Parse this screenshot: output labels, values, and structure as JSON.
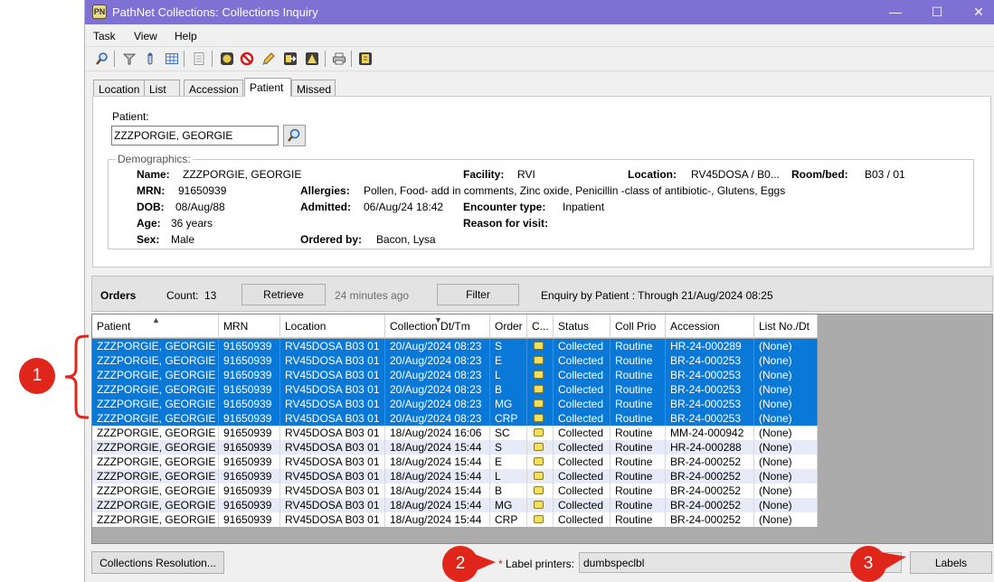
{
  "window": {
    "title": "PathNet Collections: Collections Inquiry",
    "app_icon_text": "PN",
    "minimize": "—",
    "maximize": "☐",
    "close": "✕"
  },
  "menu": [
    "Task",
    "View",
    "Help"
  ],
  "tabs": [
    "Location",
    "List",
    "Accession",
    "Patient",
    "Missed"
  ],
  "active_tab": "Patient",
  "patient_panel": {
    "patient_label": "Patient:",
    "patient_value": "ZZZPORGIE, GEORGIE",
    "demographics_legend": "Demographics:",
    "name_label": "Name:",
    "name": "ZZZPORGIE, GEORGIE",
    "mrn_label": "MRN:",
    "mrn": "91650939",
    "dob_label": "DOB:",
    "dob": "08/Aug/88",
    "age_label": "Age:",
    "age": "36 years",
    "sex_label": "Sex:",
    "sex": "Male",
    "allergies_label": "Allergies:",
    "allergies": "Pollen, Food- add in comments, Zinc oxide, Penicillin -class of antibiotic-, Glutens, Eggs",
    "admitted_label": "Admitted:",
    "admitted": "06/Aug/24 18:42",
    "ordered_by_label": "Ordered by:",
    "ordered_by": "Bacon, Lysa",
    "facility_label": "Facility:",
    "facility": "RVI",
    "encounter_label": "Encounter type:",
    "encounter": "Inpatient",
    "reason_label": "Reason for visit:",
    "reason": "",
    "location_label": "Location:",
    "location": "RV45DOSA / B0...",
    "roombed_label": "Room/bed:",
    "roombed": "B03 / 01"
  },
  "orders_bar": {
    "title": "Orders",
    "count_label": "Count:",
    "count": "13",
    "retrieve": "Retrieve",
    "elapsed": "24 minutes ago",
    "filter": "Filter",
    "enquiry": "Enquiry by Patient : Through 21/Aug/2024 08:25"
  },
  "grid": {
    "columns": [
      "Patient",
      "MRN",
      "Location",
      "Collection Dt/Tm",
      "Order",
      "C...",
      "Status",
      "Coll Prio",
      "Accession",
      "List No./Dt"
    ],
    "rows": [
      {
        "patient": "ZZZPORGIE, GEORGIE",
        "mrn": "91650939",
        "location": "RV45DOSA B03 01",
        "dt": "20/Aug/2024 08:23",
        "order": "S",
        "status": "Collected",
        "prio": "Routine",
        "accession": "HR-24-000289",
        "list": "(None)",
        "selected": true
      },
      {
        "patient": "ZZZPORGIE, GEORGIE",
        "mrn": "91650939",
        "location": "RV45DOSA B03 01",
        "dt": "20/Aug/2024 08:23",
        "order": "E",
        "status": "Collected",
        "prio": "Routine",
        "accession": "BR-24-000253",
        "list": "(None)",
        "selected": true
      },
      {
        "patient": "ZZZPORGIE, GEORGIE",
        "mrn": "91650939",
        "location": "RV45DOSA B03 01",
        "dt": "20/Aug/2024 08:23",
        "order": "L",
        "status": "Collected",
        "prio": "Routine",
        "accession": "BR-24-000253",
        "list": "(None)",
        "selected": true
      },
      {
        "patient": "ZZZPORGIE, GEORGIE",
        "mrn": "91650939",
        "location": "RV45DOSA B03 01",
        "dt": "20/Aug/2024 08:23",
        "order": "B",
        "status": "Collected",
        "prio": "Routine",
        "accession": "BR-24-000253",
        "list": "(None)",
        "selected": true
      },
      {
        "patient": "ZZZPORGIE, GEORGIE",
        "mrn": "91650939",
        "location": "RV45DOSA B03 01",
        "dt": "20/Aug/2024 08:23",
        "order": "MG",
        "status": "Collected",
        "prio": "Routine",
        "accession": "BR-24-000253",
        "list": "(None)",
        "selected": true
      },
      {
        "patient": "ZZZPORGIE, GEORGIE",
        "mrn": "91650939",
        "location": "RV45DOSA B03 01",
        "dt": "20/Aug/2024 08:23",
        "order": "CRP",
        "status": "Collected",
        "prio": "Routine",
        "accession": "BR-24-000253",
        "list": "(None)",
        "selected": true
      },
      {
        "patient": "ZZZPORGIE, GEORGIE",
        "mrn": "91650939",
        "location": "RV45DOSA B03 01",
        "dt": "18/Aug/2024 16:06",
        "order": "SC",
        "status": "Collected",
        "prio": "Routine",
        "accession": "MM-24-000942",
        "list": "(None)",
        "selected": false
      },
      {
        "patient": "ZZZPORGIE, GEORGIE",
        "mrn": "91650939",
        "location": "RV45DOSA B03 01",
        "dt": "18/Aug/2024 15:44",
        "order": "S",
        "status": "Collected",
        "prio": "Routine",
        "accession": "HR-24-000288",
        "list": "(None)",
        "selected": false
      },
      {
        "patient": "ZZZPORGIE, GEORGIE",
        "mrn": "91650939",
        "location": "RV45DOSA B03 01",
        "dt": "18/Aug/2024 15:44",
        "order": "E",
        "status": "Collected",
        "prio": "Routine",
        "accession": "BR-24-000252",
        "list": "(None)",
        "selected": false
      },
      {
        "patient": "ZZZPORGIE, GEORGIE",
        "mrn": "91650939",
        "location": "RV45DOSA B03 01",
        "dt": "18/Aug/2024 15:44",
        "order": "L",
        "status": "Collected",
        "prio": "Routine",
        "accession": "BR-24-000252",
        "list": "(None)",
        "selected": false
      },
      {
        "patient": "ZZZPORGIE, GEORGIE",
        "mrn": "91650939",
        "location": "RV45DOSA B03 01",
        "dt": "18/Aug/2024 15:44",
        "order": "B",
        "status": "Collected",
        "prio": "Routine",
        "accession": "BR-24-000252",
        "list": "(None)",
        "selected": false
      },
      {
        "patient": "ZZZPORGIE, GEORGIE",
        "mrn": "91650939",
        "location": "RV45DOSA B03 01",
        "dt": "18/Aug/2024 15:44",
        "order": "MG",
        "status": "Collected",
        "prio": "Routine",
        "accession": "BR-24-000252",
        "list": "(None)",
        "selected": false
      },
      {
        "patient": "ZZZPORGIE, GEORGIE",
        "mrn": "91650939",
        "location": "RV45DOSA B03 01",
        "dt": "18/Aug/2024 15:44",
        "order": "CRP",
        "status": "Collected",
        "prio": "Routine",
        "accession": "BR-24-000252",
        "list": "(None)",
        "selected": false
      }
    ]
  },
  "bottom": {
    "collections_resolution": "Collections Resolution...",
    "required_marker": "*",
    "label_printers_label": "Label printers:",
    "label_printers_value": "dumbspeclbl",
    "labels_button": "Labels"
  },
  "callouts": [
    "1",
    "2",
    "3"
  ],
  "colors": {
    "titlebar": "#7f70d4",
    "selection": "#0a78d7",
    "callout": "#e0261a",
    "alt_row": "#e6ebf7"
  },
  "icons": [
    "magnifier-icon",
    "funnel-icon",
    "specimen-tube-icon",
    "grid-icon",
    "document-icon",
    "green-circle-icon",
    "no-entry-icon",
    "pencil-icon",
    "exit-icon",
    "triangle-flask-icon",
    "printer-icon",
    "label-icon"
  ]
}
